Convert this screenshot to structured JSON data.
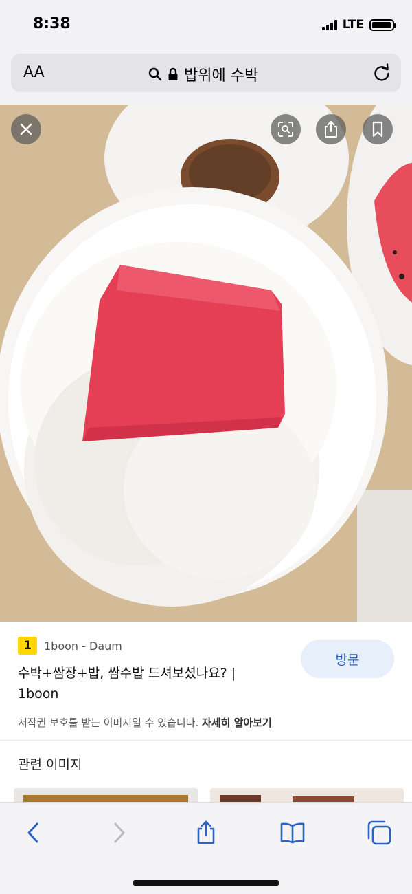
{
  "status_bar": {
    "time": "8:38",
    "network": "LTE",
    "battery_level": 0.95
  },
  "address_bar": {
    "text_size_button": "AA",
    "url_text": "밥위에 수박",
    "icons": [
      "search-icon",
      "lock-icon",
      "reload-icon"
    ]
  },
  "image_viewer": {
    "overlay_buttons": [
      "close-icon",
      "visual-lookup-icon",
      "share-icon",
      "bookmark-icon"
    ]
  },
  "result": {
    "source_badge": "1",
    "source_name": "1boon - Daum",
    "title_line1": "수박+쌈장+밥, 쌈수밥 드셔보셨나요? |",
    "title_line2": "1boon",
    "visit_button": "방문",
    "copyright_text": "저작권 보호를 받는 이미지일 수 있습니다.",
    "learn_more": "자세히 알아보기"
  },
  "related": {
    "title": "관련 이미지"
  },
  "toolbar": {
    "icons": [
      "back-icon",
      "forward-icon",
      "share-icon",
      "bookmarks-icon",
      "tabs-icon"
    ]
  },
  "colors": {
    "accent": "#2a63c7",
    "badge": "#ffd600",
    "visit_bg": "#e7effb"
  }
}
